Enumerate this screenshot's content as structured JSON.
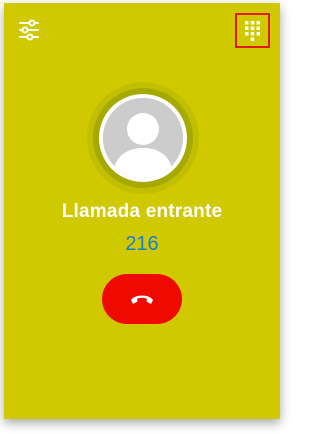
{
  "call": {
    "status_text": "Llamada entrante",
    "caller_number": "216"
  },
  "icons": {
    "settings": "sliders-icon",
    "dialpad": "dialpad-icon",
    "hangup": "phone-hangup-icon",
    "avatar": "user-placeholder-icon"
  },
  "colors": {
    "background": "#d0c900",
    "number": "#1680c9",
    "hangup": "#ee0a00",
    "dialpad_highlight": "#e01b1b"
  }
}
